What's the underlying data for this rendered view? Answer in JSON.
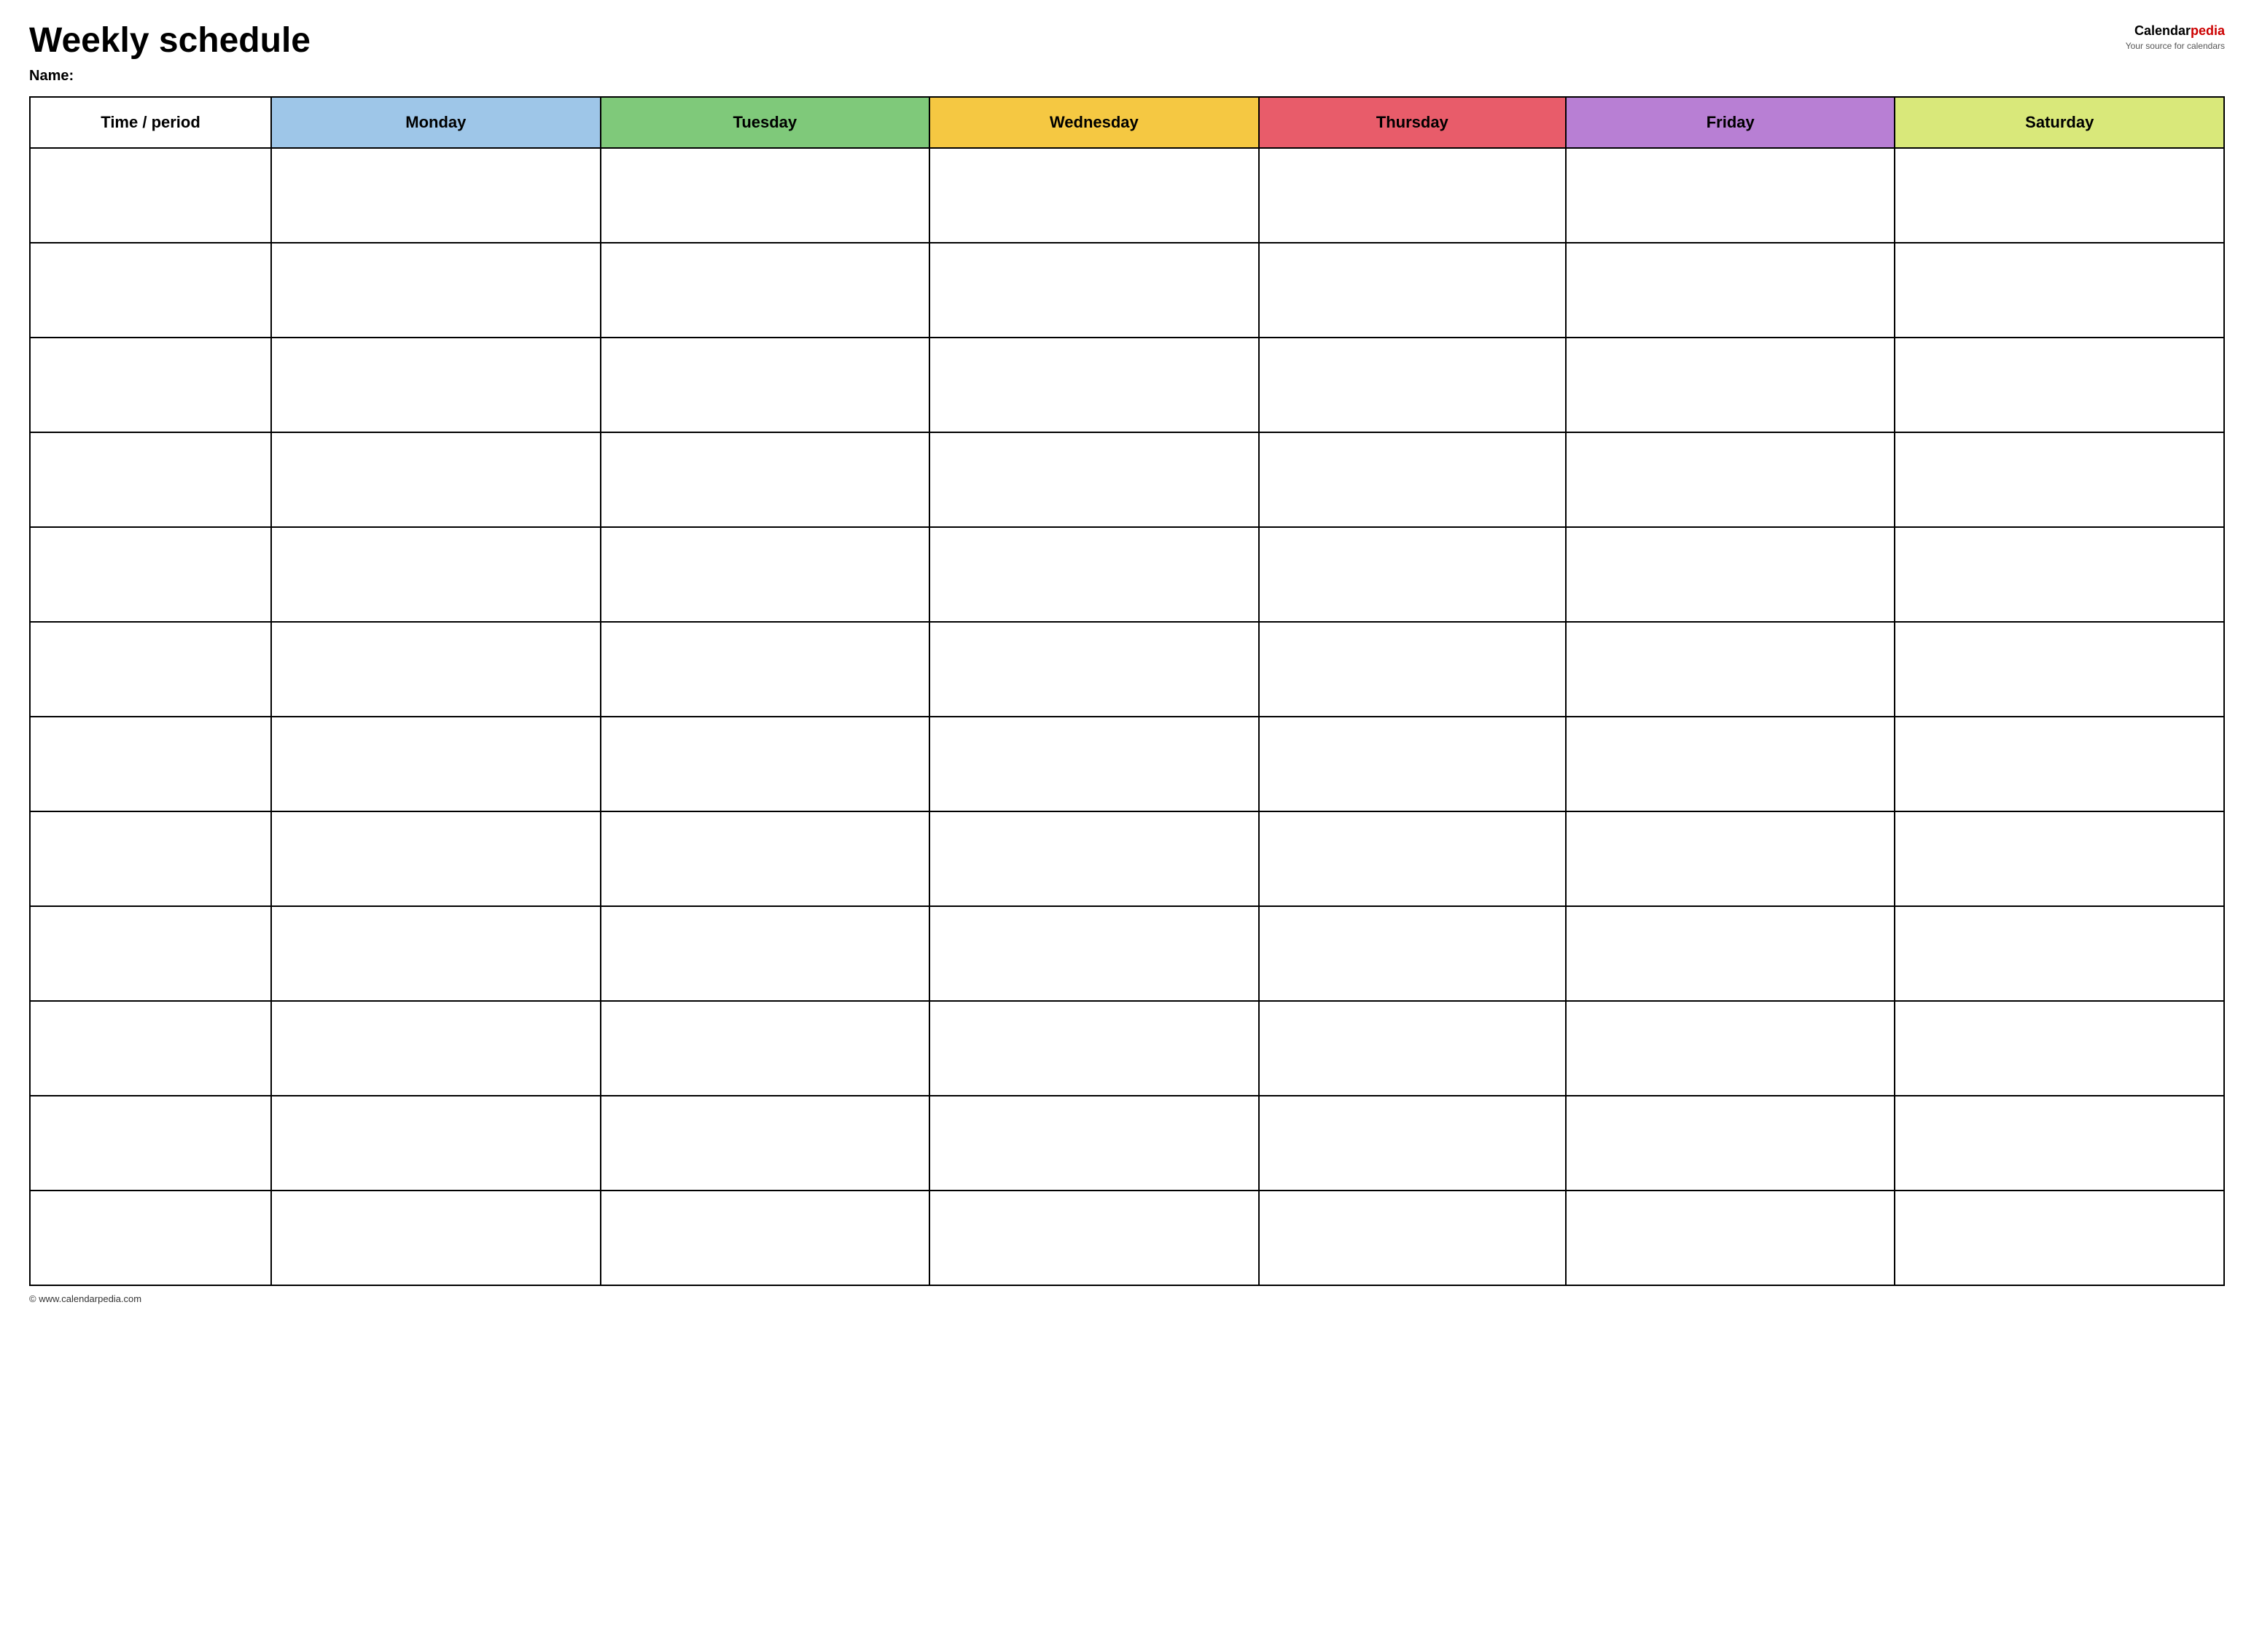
{
  "page": {
    "title": "Weekly schedule",
    "name_label": "Name:",
    "footer_url": "© www.calendarpedia.com"
  },
  "logo": {
    "calendar_text": "Calendar",
    "pedia_text": "pedia",
    "tagline": "Your source for calendars"
  },
  "table": {
    "headers": [
      {
        "id": "time",
        "label": "Time / period",
        "color": "#ffffff"
      },
      {
        "id": "monday",
        "label": "Monday",
        "color": "#9ec6e8"
      },
      {
        "id": "tuesday",
        "label": "Tuesday",
        "color": "#7fc97a"
      },
      {
        "id": "wednesday",
        "label": "Wednesday",
        "color": "#f5c842"
      },
      {
        "id": "thursday",
        "label": "Thursday",
        "color": "#e85c6a"
      },
      {
        "id": "friday",
        "label": "Friday",
        "color": "#b87fd4"
      },
      {
        "id": "saturday",
        "label": "Saturday",
        "color": "#d9e87a"
      }
    ],
    "row_count": 12
  }
}
